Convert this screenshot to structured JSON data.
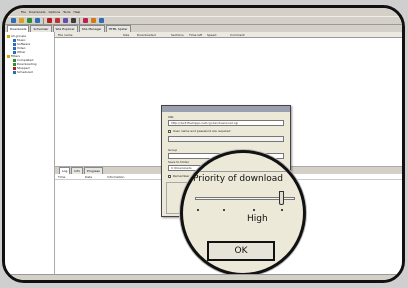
{
  "menu": [
    "File",
    "Downloads",
    "Options",
    "Tools",
    "Help"
  ],
  "toolbar": {
    "buttons": [
      {
        "icon": "add-icon",
        "color": "#2c6db5"
      },
      {
        "icon": "open-icon",
        "color": "#d9a21b"
      },
      {
        "icon": "play-icon",
        "color": "#2e8b2e"
      },
      {
        "icon": "pause-icon",
        "color": "#2c6db5"
      },
      {
        "icon": "stop-icon",
        "color": "#b02020"
      },
      {
        "icon": "delete-icon",
        "color": "#c03030"
      },
      {
        "icon": "scheduler-icon",
        "color": "#6a4bb0"
      },
      {
        "icon": "settings-icon",
        "color": "#3a3a3a"
      },
      {
        "icon": "site-explorer-icon",
        "color": "#c02050"
      },
      {
        "icon": "spider-icon",
        "color": "#d27b14"
      },
      {
        "icon": "help-icon",
        "color": "#2c6db5"
      }
    ]
  },
  "tabs": [
    "Downloads",
    "Scheduler",
    "Site Explorer",
    "Site Manager",
    "HTML Spider"
  ],
  "sidebar": {
    "items": [
      {
        "label": "All groups",
        "level": 0,
        "color": "#d9a21b"
      },
      {
        "label": "Music",
        "level": 1,
        "color": "#2c6db5"
      },
      {
        "label": "Software",
        "level": 1,
        "color": "#2c6db5"
      },
      {
        "label": "Video",
        "level": 1,
        "color": "#2c6db5"
      },
      {
        "label": "Other",
        "level": 1,
        "color": "#2c6db5"
      },
      {
        "label": "Filters",
        "level": 0,
        "color": "#d9a21b"
      },
      {
        "label": "Completed",
        "level": 1,
        "color": "#2e8b2e"
      },
      {
        "label": "Downloading",
        "level": 1,
        "color": "#2e8b2e"
      },
      {
        "label": "Stopped",
        "level": 1,
        "color": "#b02020"
      },
      {
        "label": "Scheduled",
        "level": 1,
        "color": "#2c6db5"
      }
    ]
  },
  "columns": [
    {
      "label": "File name"
    },
    {
      "label": "Size"
    },
    {
      "label": "Downloaded"
    },
    {
      "label": "Sections"
    },
    {
      "label": "Time left"
    },
    {
      "label": "Speed"
    },
    {
      "label": "Comment"
    }
  ],
  "bottom_tabs": [
    "Log",
    "Info",
    "Progress"
  ],
  "log_columns": [
    "Time",
    "Date",
    "Information"
  ],
  "dialog": {
    "url_label": "URL",
    "url_value": "http://dw3.filehippo.net/cgi-bin/download.cgi",
    "auth_label": "User name and password are required",
    "group_label": "Group",
    "save_label": "Save to folder",
    "save_value": "C:\\Downloads",
    "checkbox_label": "Remember",
    "priority_label": "Priority of download",
    "priority_value": "High",
    "ok_label": "OK"
  }
}
